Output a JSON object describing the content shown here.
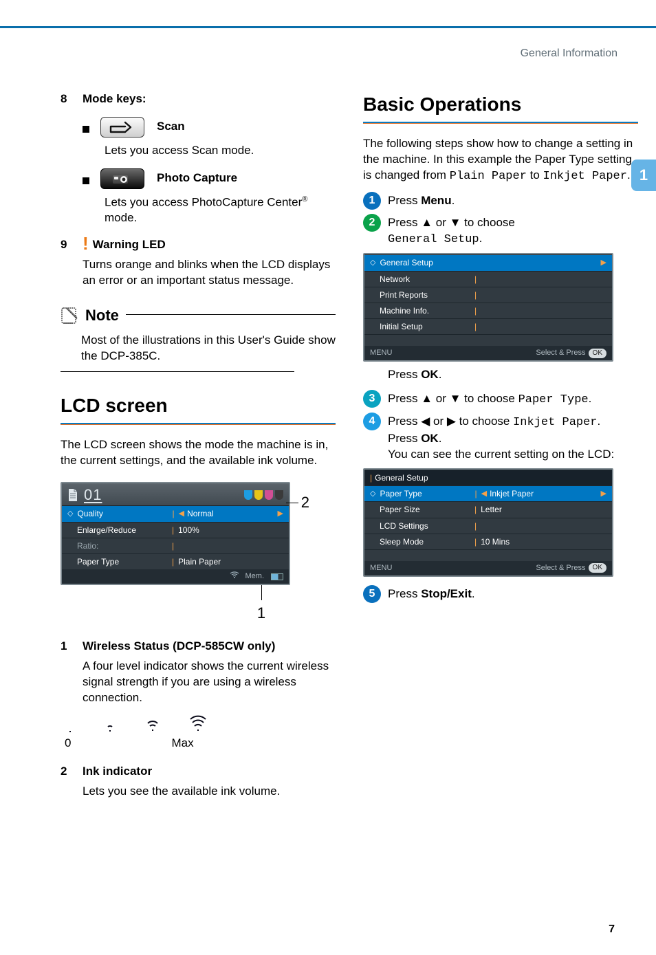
{
  "header": {
    "section": "General Information"
  },
  "chapter_tab": "1",
  "page_number": "7",
  "left": {
    "item8": {
      "num": "8",
      "title": "Mode keys:",
      "scan": {
        "label": "Scan",
        "desc": "Lets you access Scan mode."
      },
      "photo": {
        "label": "Photo Capture",
        "desc_pre": "Lets you access PhotoCapture Center",
        "desc_sup": "®",
        "desc_post": " mode."
      }
    },
    "item9": {
      "num": "9",
      "title": "Warning LED",
      "desc": "Turns orange and blinks when the LCD displays an error or an important status message."
    },
    "note": {
      "title": "Note",
      "text": "Most of the illustrations in this User's Guide show the DCP-385C."
    },
    "lcd_section": {
      "title": "LCD screen",
      "intro": "The LCD screen shows the mode the machine is in, the current settings, and the available ink volume."
    },
    "lcd_panel": {
      "copies_label": "01",
      "ink_colors": [
        "#1d9de3",
        "#e6c419",
        "#d14f94",
        "#3a3a3a"
      ],
      "rows": [
        {
          "label": "Quality",
          "value": "Normal",
          "nav": true,
          "selected": true
        },
        {
          "label": "Enlarge/Reduce",
          "value": "100%"
        },
        {
          "label": "Ratio:",
          "value": "",
          "muted": true
        },
        {
          "label": "Paper Type",
          "value": "Plain Paper"
        }
      ],
      "foot_mem": "Mem."
    },
    "callout1": "1",
    "callout2": "2",
    "sub1": {
      "num": "1",
      "title": "Wireless Status (DCP-585CW only)",
      "desc": "A four level indicator shows the current wireless signal strength if you are using a wireless connection.",
      "scale_min": "0",
      "scale_max": "Max"
    },
    "sub2": {
      "num": "2",
      "title": "Ink indicator",
      "desc": "Lets you see the available ink volume."
    }
  },
  "right": {
    "title": "Basic Operations",
    "intro_1": "The following steps show how to change a setting in the machine. In this example the Paper Type setting is changed from ",
    "intro_from": "Plain Paper",
    "intro_to_word": " to ",
    "intro_to": "Inkjet Paper",
    "intro_end": ".",
    "steps": {
      "s1_pre": "Press ",
      "s1_bold": "Menu",
      "s1_post": ".",
      "s2_pre": "Press ",
      "s2_mid": " or ",
      "s2_post": " to choose",
      "s2_choice": "General Setup",
      "s2_end": ".",
      "s2_ok_pre": "Press ",
      "s2_ok": "OK",
      "s2_ok_post": ".",
      "s3_pre": "Press ",
      "s3_mid": " or ",
      "s3_post": " to choose ",
      "s3_choice": "Paper Type",
      "s3_end": ".",
      "s4_pre": "Press ",
      "s4_mid": " or ",
      "s4_post": " to choose ",
      "s4_choice": "Inkjet Paper",
      "s4_end": ".",
      "s4_line2_pre": "Press ",
      "s4_line2_bold": "OK",
      "s4_line2_post": ".",
      "s4_line3": "You can see the current setting on the LCD:",
      "s5_pre": "Press ",
      "s5_bold": "Stop/Exit",
      "s5_post": "."
    },
    "lcd_menu1": {
      "rows": [
        {
          "label": "General Setup",
          "selected": true,
          "nav_right": true
        },
        {
          "label": "Network"
        },
        {
          "label": "Print Reports"
        },
        {
          "label": "Machine Info."
        },
        {
          "label": "Initial Setup"
        }
      ],
      "foot_left": "MENU",
      "foot_right": "Select & Press",
      "foot_ok": "OK"
    },
    "lcd_menu2": {
      "title": "General Setup",
      "rows": [
        {
          "label": "Paper Type",
          "value": "Inkjet Paper",
          "selected": true,
          "nav": true
        },
        {
          "label": "Paper Size",
          "value": "Letter"
        },
        {
          "label": "LCD Settings",
          "value": ""
        },
        {
          "label": "Sleep Mode",
          "value": "10 Mins"
        }
      ],
      "foot_left": "MENU",
      "foot_right": "Select & Press",
      "foot_ok": "OK"
    },
    "step_colors": {
      "1": "#0970bd",
      "2": "#0aa24a",
      "3": "#0aa3c0",
      "4": "#1d9de3",
      "5": "#0970bd"
    }
  }
}
